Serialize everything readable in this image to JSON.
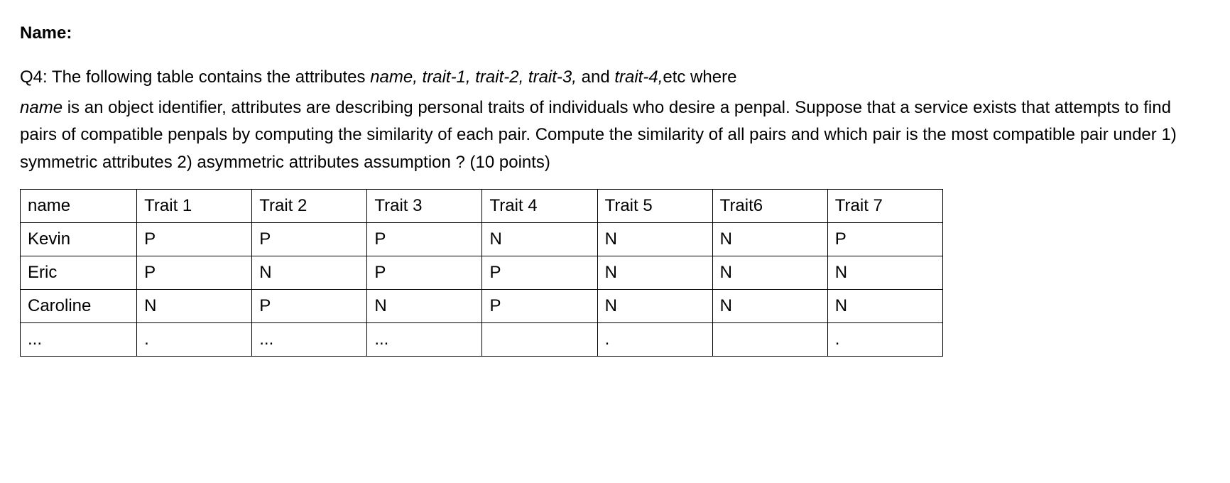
{
  "header": {
    "name_label": "Name:"
  },
  "question": {
    "q_label": "Q4:",
    "line1_pre": " The following table contains the attributes ",
    "attrs_list": "name, trait-1, trait-2, trait-3,",
    "line1_mid": " and ",
    "attrs_last": "trait-4,",
    "line1_post": "etc where",
    "line2_pre_italic": "name",
    "line2_post": " is an object identifier, attributes are describing personal traits of individuals who desire a penpal. Suppose that a service exists that attempts to find pairs of compatible penpals by computing the similarity of each pair.  Compute the similarity of all pairs and which pair is the most compatible pair under 1) symmetric attributes 2)  asymmetric attributes assumption ? (10 points)"
  },
  "table": {
    "headers": [
      "name",
      "Trait 1",
      "Trait 2",
      "Trait 3",
      "Trait 4",
      "Trait 5",
      "Trait6",
      "Trait 7"
    ],
    "rows": [
      {
        "cells": [
          "Kevin",
          "P",
          "P",
          "P",
          "N",
          "N",
          "N",
          "P"
        ]
      },
      {
        "cells": [
          "Eric",
          "P",
          "N",
          "P",
          "P",
          "N",
          "N",
          "N"
        ]
      },
      {
        "cells": [
          "Caroline",
          "N",
          "P",
          "N",
          "P",
          "N",
          "N",
          "N"
        ]
      },
      {
        "cells": [
          "...",
          ".",
          "...",
          "...",
          "",
          ".",
          "",
          "."
        ]
      }
    ]
  }
}
